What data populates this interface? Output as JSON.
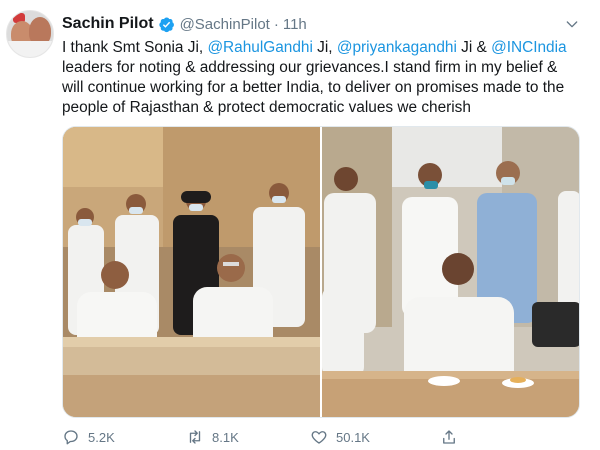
{
  "tweet": {
    "author_name": "Sachin Pilot",
    "handle": "@SachinPilot",
    "separator": "·",
    "time": "11h",
    "lines": [
      [
        {
          "t": "I thank Smt Sonia Ji, ",
          "m": false
        },
        {
          "t": "@RahulGandhi",
          "m": true
        },
        {
          "t": " Ji, ",
          "m": false
        },
        {
          "t": "@priyankagandhi",
          "m": true
        },
        {
          "t": " Ji & ",
          "m": false
        },
        {
          "t": "@INCIndia",
          "m": true
        }
      ],
      [
        {
          "t": "leaders for noting & addressing our grievances.I stand firm in my belief &",
          "m": false
        }
      ],
      [
        {
          "t": "will continue working for a better India, to deliver on promises made to the",
          "m": false
        }
      ],
      [
        {
          "t": "people of Rajasthan & protect democratic values we cherish",
          "m": false
        }
      ]
    ]
  },
  "icons": {
    "avatar": "profile-photo",
    "verified": "verified-badge-icon",
    "more": "chevron-down-icon",
    "reply": "reply-icon",
    "retweet": "retweet-icon",
    "like": "heart-icon",
    "share": "share-icon"
  },
  "actions": {
    "replies": "5.2K",
    "retweets": "8.1K",
    "likes": "50.1K"
  },
  "colors": {
    "mention": "#1b95e0",
    "secondary_text": "#657786",
    "verified": "#1da1f2"
  }
}
